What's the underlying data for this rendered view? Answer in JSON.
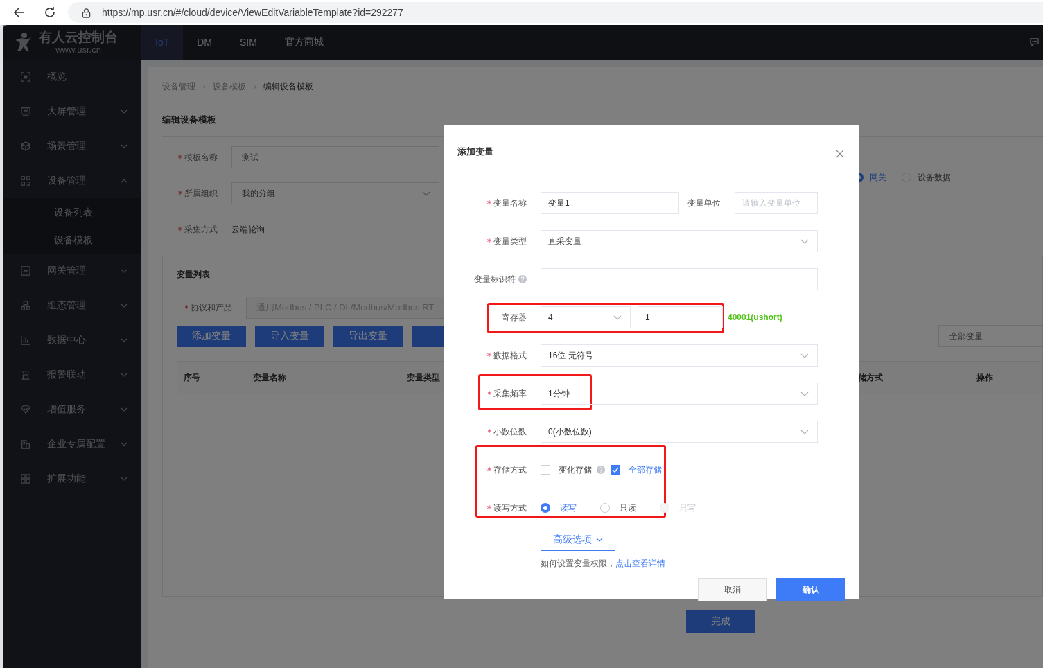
{
  "browser": {
    "url": "https://mp.usr.cn/#/cloud/device/ViewEditVariableTemplate?id=292277"
  },
  "brand": {
    "name": "有人云控制台",
    "site": "www.usr.cn"
  },
  "top_nav": [
    {
      "label": "IoT",
      "selected": true
    },
    {
      "label": "DM",
      "selected": false
    },
    {
      "label": "SIM",
      "selected": false
    },
    {
      "label": "官方商城",
      "selected": false
    }
  ],
  "sidebar": {
    "items": [
      {
        "kind": "link",
        "label": "概览"
      },
      {
        "kind": "group",
        "label": "大屏管理",
        "expanded": false
      },
      {
        "kind": "group",
        "label": "场景管理",
        "expanded": false
      },
      {
        "kind": "group",
        "label": "设备管理",
        "expanded": true,
        "children": [
          {
            "label": "设备列表"
          },
          {
            "label": "设备模板"
          }
        ]
      },
      {
        "kind": "group",
        "label": "网关管理",
        "expanded": false
      },
      {
        "kind": "group",
        "label": "组态管理",
        "expanded": false
      },
      {
        "kind": "group",
        "label": "数据中心",
        "expanded": false
      },
      {
        "kind": "group",
        "label": "报警联动",
        "expanded": false
      },
      {
        "kind": "group",
        "label": "增值服务",
        "expanded": false
      },
      {
        "kind": "group",
        "label": "企业专属配置",
        "expanded": false
      },
      {
        "kind": "group",
        "label": "扩展功能",
        "expanded": false
      }
    ]
  },
  "breadcrumb": [
    "设备管理",
    "设备模板",
    "编辑设备模板"
  ],
  "page_title": "编辑设备模板",
  "template_form": [
    {
      "kind": "input",
      "label": "模板名称",
      "required": true,
      "value": "测试"
    },
    {
      "kind": "select",
      "label": "所属组织",
      "required": true,
      "value": "我的分组"
    },
    {
      "kind": "text",
      "label": "采集方式",
      "required": true,
      "value": "云端轮询"
    }
  ],
  "source_radios": [
    {
      "label": "网关",
      "selected": true
    },
    {
      "label": "设备数据",
      "selected": false
    }
  ],
  "variable_list": {
    "title": "变量列表",
    "protocol": {
      "label": "协议和产品",
      "required": true,
      "value": "通用Modbus / PLC / DL/Modbus/Modbus RT"
    },
    "buttons": [
      "添加变量",
      "导入变量",
      "导出变量"
    ],
    "filter": "全部变量",
    "columns": [
      "序号",
      "变量名称",
      "变量类型",
      "储方式",
      "操作"
    ]
  },
  "done_button": "完成",
  "dialog": {
    "title": "添加变量",
    "fields": [
      {
        "kind": "text_pair",
        "label": "变量名称",
        "required": true,
        "help": false,
        "highlighted": false,
        "value": "变量1",
        "unit_label": "变量单位",
        "unit_placeholder": "请输入变量单位"
      },
      {
        "kind": "select",
        "label": "变量类型",
        "required": true,
        "help": false,
        "highlighted": false,
        "value": "直采变量"
      },
      {
        "kind": "input",
        "label": "变量标识符",
        "required": false,
        "help": true,
        "highlighted": false
      },
      {
        "kind": "register",
        "label": "寄存器",
        "required": false,
        "help": false,
        "highlighted": true,
        "area": "4",
        "address": "1",
        "hint": "40001(ushort)"
      },
      {
        "kind": "select",
        "label": "数据格式",
        "required": true,
        "help": false,
        "highlighted": false,
        "value": "16位 无符号"
      },
      {
        "kind": "select",
        "label": "采集频率",
        "required": true,
        "help": false,
        "highlighted": true,
        "value": "1分钟"
      },
      {
        "kind": "select",
        "label": "小数位数",
        "required": true,
        "help": false,
        "highlighted": false,
        "value": "0(小数位数)"
      },
      {
        "kind": "choice_group",
        "highlighted": true,
        "rows": [
          {
            "kind": "checkboxes",
            "label": "存储方式",
            "required": true,
            "options": [
              {
                "label": "变化存储",
                "checked": false,
                "help": true
              },
              {
                "label": "全部存储",
                "checked": true,
                "help": false
              }
            ]
          },
          {
            "kind": "radios",
            "label": "读写方式",
            "required": true,
            "options": [
              {
                "label": "读写",
                "selected": true,
                "disabled": false
              },
              {
                "label": "只读",
                "selected": false,
                "disabled": false
              },
              {
                "label": "只写",
                "selected": false,
                "disabled": true
              }
            ]
          }
        ]
      }
    ],
    "advanced_button": "高级选项",
    "note": "如何设置变量权限，",
    "note_link": "点击查看详情",
    "cancel_button": "取消",
    "confirm_button": "确认"
  }
}
